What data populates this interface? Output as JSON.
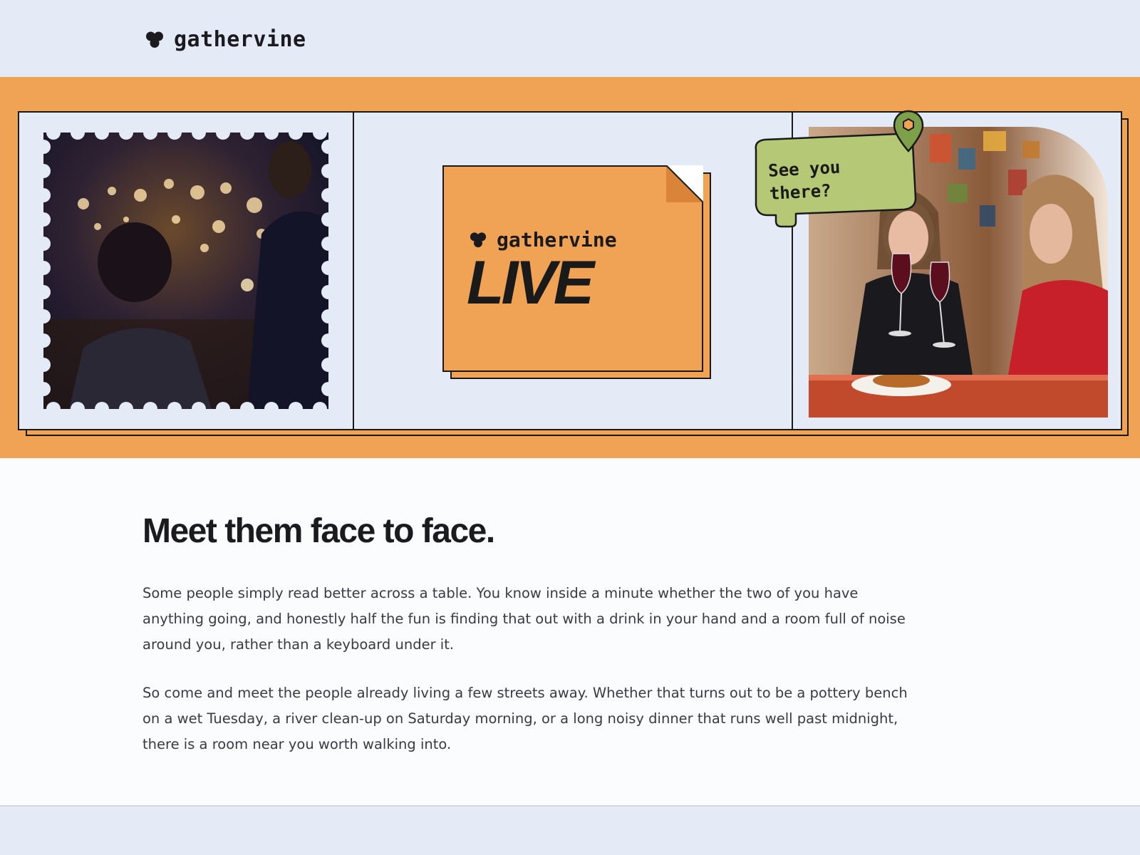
{
  "header": {
    "brand_name": "gathervine",
    "logo_icon": "trefoil-logo-icon"
  },
  "hero": {
    "card": {
      "brand_name": "gathervine",
      "title": "LIVE"
    },
    "bubble": {
      "text": "See you there?",
      "icon": "location-pin-icon"
    },
    "left_photo": "night-market-couple-photo",
    "right_photo": "friends-toasting-wine-photo"
  },
  "main": {
    "headline": "Meet them face to face.",
    "paragraphs": [
      "Some people simply read better across a table. You know inside a minute whether the two of you have anything going, and honestly half the fun is finding that out with a drink in your hand and a room full of noise around you, rather than a keyboard under it.",
      "So come and meet the people already living a few streets away. Whether that turns out to be a pottery bench on a wet Tuesday, a river clean-up on Saturday morning, or a long noisy dinner that runs well past midnight, there is a room near you worth walking into."
    ]
  },
  "colors": {
    "topbar_bg": "#e5eaf7",
    "hero_orange": "#f0a354",
    "bubble_green": "#b5c876",
    "ink": "#1a1a1a"
  }
}
